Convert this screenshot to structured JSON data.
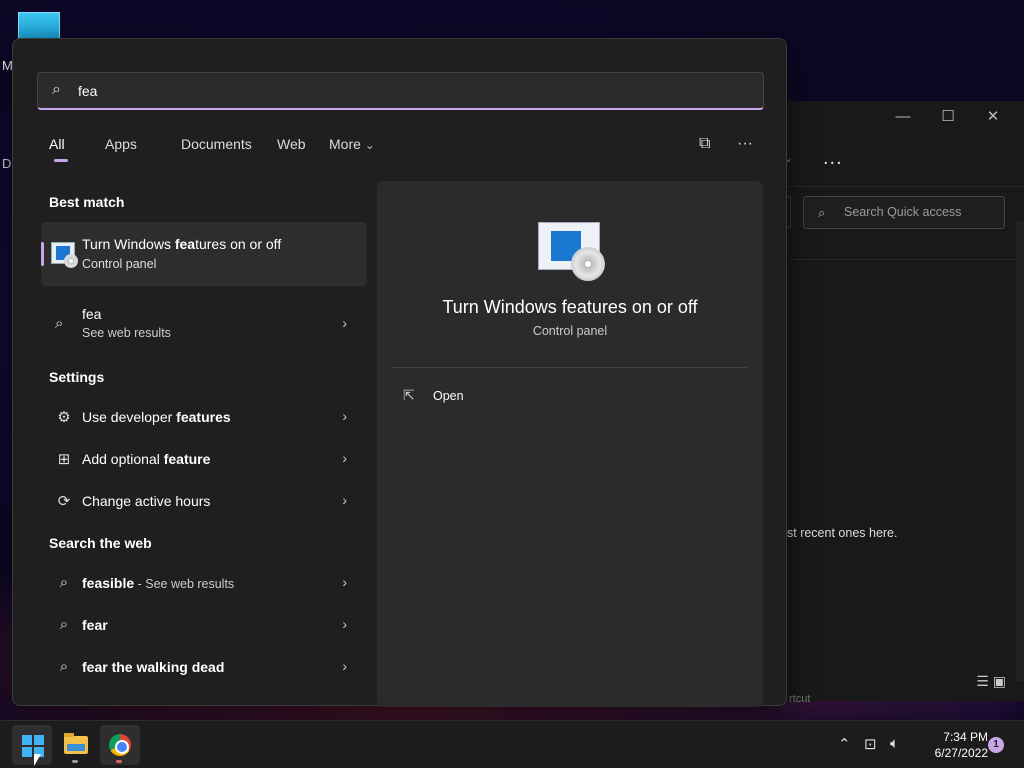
{
  "desktop": {
    "label_m": "M",
    "label_d": "D:"
  },
  "explorer": {
    "minimize": "—",
    "maximize": "☐",
    "close": "✕",
    "more": "...",
    "search_placeholder": "Search Quick access",
    "recent_text": "st recent ones here.",
    "shortcut_text": "rtcut"
  },
  "search": {
    "value": "fea",
    "tabs": [
      "All",
      "Apps",
      "Documents",
      "Web",
      "More"
    ],
    "more_chevron": "⌄",
    "share_icon": "⧉",
    "options_icon": "···"
  },
  "results": {
    "best_match_heading": "Best match",
    "best_match": {
      "title_pre": "Turn Windows ",
      "title_bold": "fea",
      "title_post": "tures on or off",
      "subtitle": "Control panel"
    },
    "web_result": {
      "title": "fea",
      "subtitle": "See web results"
    },
    "settings_heading": "Settings",
    "settings": [
      {
        "pre": "Use developer ",
        "bold": "features",
        "icon": "⚙"
      },
      {
        "pre": "Add optional ",
        "bold": "feature",
        "icon": "⊞"
      },
      {
        "pre": "Change active hours",
        "bold": "",
        "icon": "⟳"
      }
    ],
    "web_heading": "Search the web",
    "web": [
      {
        "bold": "feasible",
        "sub": " - See web results"
      },
      {
        "bold": "fear",
        "sub": ""
      },
      {
        "bold": "fear the walking dead",
        "sub": ""
      }
    ]
  },
  "preview": {
    "title": "Turn Windows features on or off",
    "subtitle": "Control panel",
    "open_label": "Open"
  },
  "taskbar": {
    "time": "7:34 PM",
    "date": "6/27/2022",
    "notifications": "1"
  }
}
